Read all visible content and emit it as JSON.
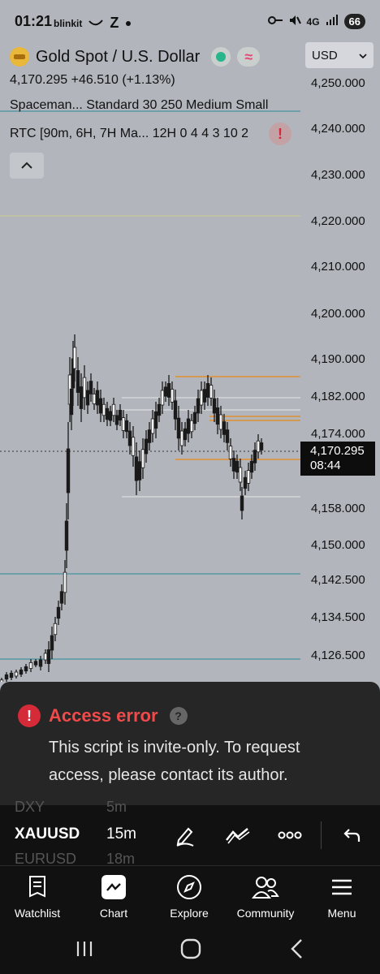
{
  "status_bar": {
    "time": "01:21",
    "notif_1": "blinkit",
    "notif_2": "Z",
    "network": "4G",
    "battery": "66"
  },
  "header": {
    "title": "Gold Spot / U.S. Dollar",
    "currency": "USD",
    "price_line": "4,170.295  +46.510 (+1.13%)",
    "indicator_1": "Spaceman...   Standard 30 250 Medium Small",
    "indicator_2": "RTC [90m, 6H, 7H Ma...  12H 0 4 4 3 10 2"
  },
  "price_axis": {
    "labels": [
      "4,250.000",
      "4,240.000",
      "4,230.000",
      "4,220.000",
      "4,210.000",
      "4,200.000",
      "4,190.000",
      "4,182.000",
      "4,174.000",
      "4,158.000",
      "4,150.000",
      "4,142.500",
      "4,134.500",
      "4,126.500"
    ],
    "current_price": "4,170.295",
    "countdown": "08:44"
  },
  "error": {
    "title": "Access error",
    "message": "This script is invite-only. To request access, please contact its author."
  },
  "toolbar": {
    "symbol": "XAUUSD",
    "interval": "15m",
    "ghost_prev_symbol": "DXY",
    "ghost_prev_interval": "5m",
    "ghost_next_symbol": "EURUSD",
    "ghost_next_interval": "18m"
  },
  "bottom_nav": {
    "items": [
      "Watchlist",
      "Chart",
      "Explore",
      "Community",
      "Menu"
    ]
  },
  "colors": {
    "chart_bg": "#b2b5bc",
    "orange_line": "#e0902e",
    "teal_line": "#2a8a9c",
    "error_red": "#f04a4a"
  }
}
